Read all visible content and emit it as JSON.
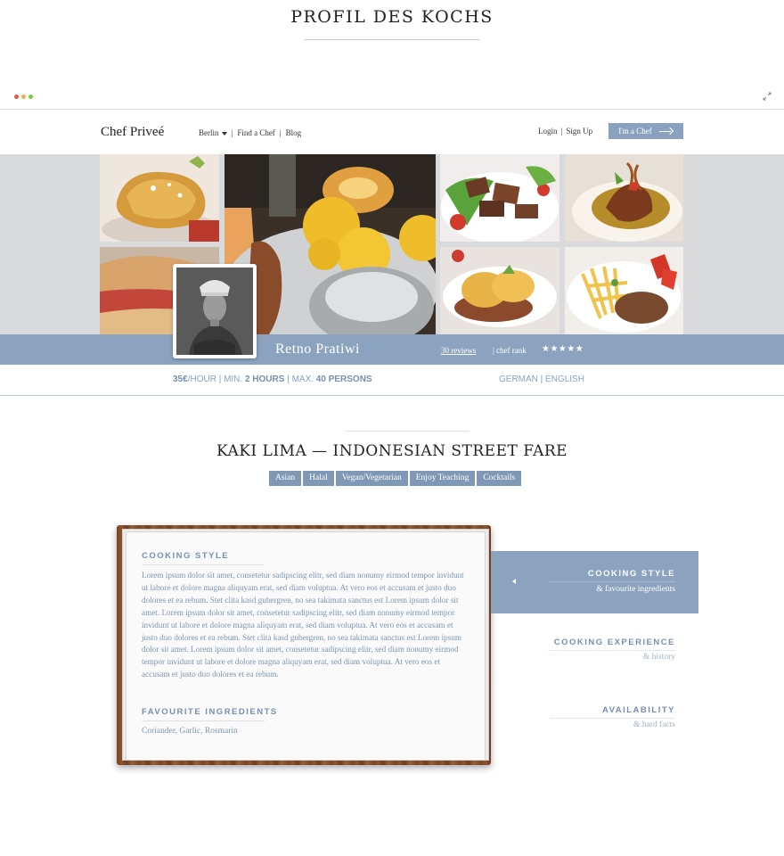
{
  "page": {
    "title": "PROFIL DES KOCHS"
  },
  "window": {
    "dot_colors": [
      "#e25b3c",
      "#f0b23e",
      "#7cc84a"
    ]
  },
  "nav": {
    "brand": "Chef Priveé",
    "city": "Berlin",
    "find_chef": "Find a Chef",
    "blog": "Blog",
    "login": "Login",
    "signup": "Sign Up",
    "chef_button": "I'm a Chef"
  },
  "profile": {
    "name": "Retno Pratiwi",
    "reviews": "30 reviews",
    "rank_label": "| chef rank",
    "stars": "★★★★★",
    "rating": 5,
    "price": "35€",
    "price_unit": "/HOUR | MIN.",
    "min_hours": "2 HOURS",
    "max_label": "| MAX.",
    "max_persons": "40 PERSONS",
    "languages": "GERMAN | ENGLISH"
  },
  "dish": {
    "title": "KAKI LIMA — INDONESIAN STREET FARE",
    "tags": [
      "Asian",
      "Halal",
      "Vegan/Vegetarian",
      "Enjoy Teaching",
      "Cocktails"
    ]
  },
  "card": {
    "section1_title": "COOKING STYLE",
    "section1_text": "Lorem ipsum dolor sit amet, consetetur sadipscing elitr, sed diam nonumy eirmod tempor invidunt ut labore et dolore magna aliquyam erat, sed diam voluptua. At vero eos et accusam et justo duo dolores et ea rebum. Stet clita kasd gubergren, no sea takimata sanctus est Lorem ipsum dolor sit amet. Lorem ipsum dolor sit amet, consetetur sadipscing elitr, sed diam nonumy eirmod tempor invidunt ut labore et dolore magna aliquyam erat, sed diam voluptua. At vero eos et accusam et justo duo dolores et ea rebum. Stet clita kasd gubergren, no sea takimata sanctus est Lorem ipsum dolor sit amet. Lorem ipsum dolor sit amet, consetetur sadipscing elitr, sed diam nonumy eirmod tempor invidunt ut labore et dolore magna aliquyam erat, sed diam voluptua. At vero eos et accusam et justo duo dolores et ea rebum.",
    "section2_title": "FAVOURITE INGREDIENTS",
    "section2_text": "Coriander, Garlic, Rosmarin"
  },
  "side_tabs": [
    {
      "title": "COOKING STYLE",
      "subtitle": "& favourite ingredients",
      "active": true
    },
    {
      "title": "COOKING EXPERIENCE",
      "subtitle": "& history",
      "active": false
    },
    {
      "title": "AVAILABILITY",
      "subtitle": "& hard facts",
      "active": false
    }
  ],
  "colors": {
    "accent": "#8ba3be",
    "tag": "#7f98b6",
    "text_blue": "#7d95b3"
  },
  "icons": [
    "window-dots",
    "expand-icon",
    "caret-down-icon",
    "arrow-right-icon",
    "star-icon",
    "chevron-left-icon"
  ]
}
